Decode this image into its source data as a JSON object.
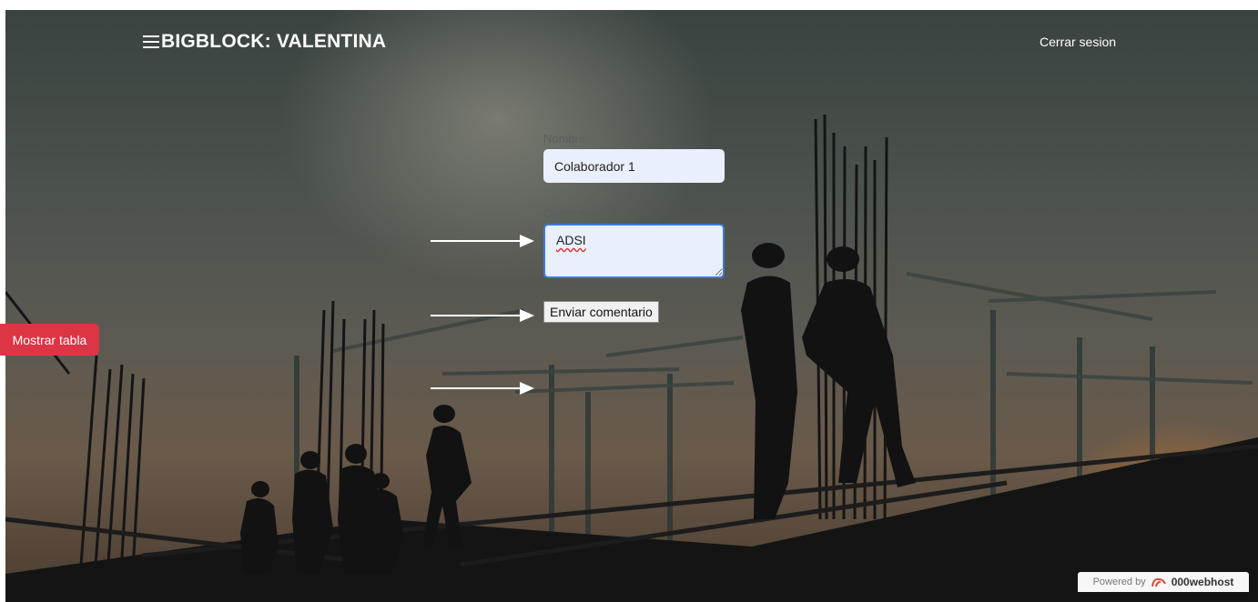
{
  "header": {
    "title": "BIGBLOCK: VALENTINA",
    "menu_icon": "hamburger-icon",
    "logout_label": "Cerrar sesion"
  },
  "form": {
    "name_label": "Nombre:",
    "name_value": "Colaborador 1",
    "comment_label": "Comentario:",
    "comment_value": "ADSI",
    "submit_label": "Enviar comentario"
  },
  "sidebar": {
    "show_table_label": "Mostrar tabla"
  },
  "footer": {
    "powered_by": "Powered by",
    "host_name": "000webhost"
  },
  "colors": {
    "show_table_button": "#dc3545",
    "input_background": "#e9effc",
    "focus_border": "#3d7bd9"
  }
}
